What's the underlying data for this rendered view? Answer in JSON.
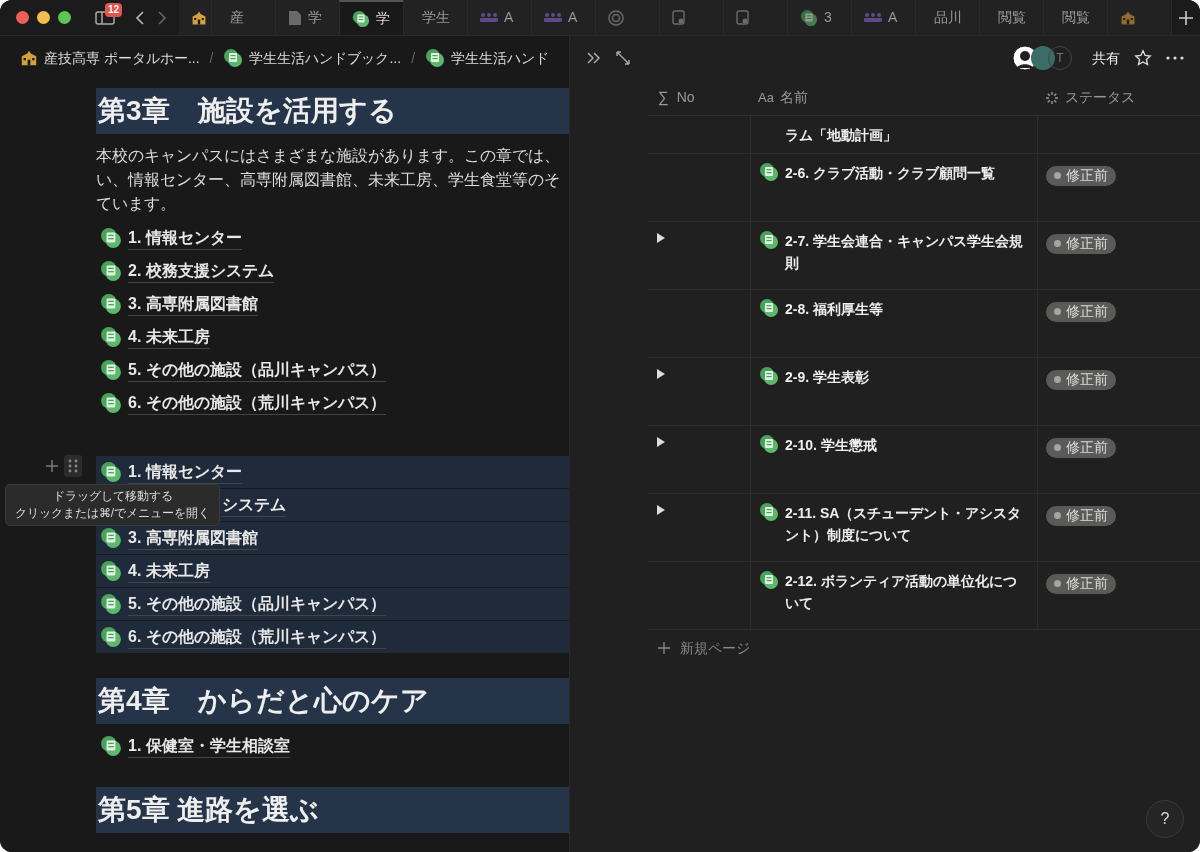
{
  "tabs": [
    {
      "kind": "school"
    },
    {
      "kind": "plain",
      "text": "産",
      "selected": false
    },
    {
      "kind": "doc",
      "text": "学",
      "selected": false
    },
    {
      "kind": "page",
      "text": "学",
      "selected": true
    },
    {
      "kind": "plain",
      "text": "学生",
      "selected": false
    },
    {
      "kind": "people",
      "text": "A",
      "selected": false
    },
    {
      "kind": "people",
      "text": "A",
      "selected": false
    },
    {
      "kind": "target",
      "selected": false
    },
    {
      "kind": "note",
      "selected": false
    },
    {
      "kind": "note",
      "selected": false
    },
    {
      "kind": "page",
      "text": "3",
      "selected": false
    },
    {
      "kind": "people",
      "text": "A",
      "selected": false
    },
    {
      "kind": "plain",
      "text": "品川",
      "selected": false
    },
    {
      "kind": "plain",
      "text": "閲覧",
      "selected": false
    },
    {
      "kind": "plain",
      "text": "閲覧",
      "selected": false
    },
    {
      "kind": "school",
      "selected": false
    }
  ],
  "tab_badge": "12",
  "breadcrumb": [
    {
      "kind": "school",
      "text": "産技高専 ポータルホー..."
    },
    {
      "kind": "page",
      "separator": "/",
      "text": "学生生活ハンドブック..."
    },
    {
      "kind": "page",
      "separator": "/",
      "text": "学生生活ハンド"
    }
  ],
  "header": {
    "avatar_letter": "T",
    "share": "共有"
  },
  "document": [
    {
      "kind": "heading",
      "text": "第3章　施設を活用する"
    },
    {
      "kind": "paragraph",
      "lines": [
        "本校のキャンパスにはさまざまな施設があります。この章では、",
        "い、情報センター、高専附属図書館、未来工房、学生食堂等のそ",
        "ています。"
      ]
    },
    {
      "kind": "links",
      "selected": false,
      "items": [
        "1.  情報センター",
        "2.  校務支援システム",
        "3.  高専附属図書館",
        "4.  未来工房",
        "5.  その他の施設（品川キャンパス）",
        "6.  その他の施設（荒川キャンパス）"
      ]
    },
    {
      "kind": "links",
      "selected": true,
      "items": [
        "1.  情報センター",
        "システム",
        "3.  高専附属図書館",
        "4.  未来工房",
        "5.  その他の施設（品川キャンパス）",
        "6.  その他の施設（荒川キャンパス）"
      ]
    },
    {
      "kind": "heading",
      "text": "第4章　からだと心のケア"
    },
    {
      "kind": "links",
      "selected": false,
      "items": [
        "1.  保健室・学生相談室"
      ]
    },
    {
      "kind": "heading",
      "text": "第5章 進路を選ぶ"
    }
  ],
  "tooltip": {
    "lines": [
      "ドラッグして移動する",
      "クリックまたは⌘/でメニューを開く"
    ]
  },
  "table": {
    "columns": [
      {
        "symbol": "∑",
        "label": "No"
      },
      {
        "symbol": "Aa",
        "label": "名前"
      },
      {
        "label": "ステータス"
      }
    ],
    "rows": [
      {
        "name": "ラム「地動計画」",
        "expandable": false
      },
      {
        "name": "2-6.  クラブ活動・クラブ顧問一覧",
        "status": "修正前",
        "expandable": false
      },
      {
        "name": "2-7.  学生会連合・キャンパス学生会規則",
        "status": "修正前",
        "expandable": true
      },
      {
        "name": "2-8.  福利厚生等",
        "status": "修正前",
        "expandable": false
      },
      {
        "name": "2-9.  学生表彰",
        "status": "修正前",
        "expandable": true
      },
      {
        "name": "2-10.  学生懲戒",
        "status": "修正前",
        "expandable": true
      },
      {
        "name": "2-11.  SA（スチューデント・アシスタント）制度について",
        "status": "修正前",
        "expandable": true
      },
      {
        "name": "2-12.  ボランティア活動の単位化について",
        "status": "修正前",
        "expandable": false
      }
    ],
    "new_page": "新規ページ"
  },
  "help": "?"
}
